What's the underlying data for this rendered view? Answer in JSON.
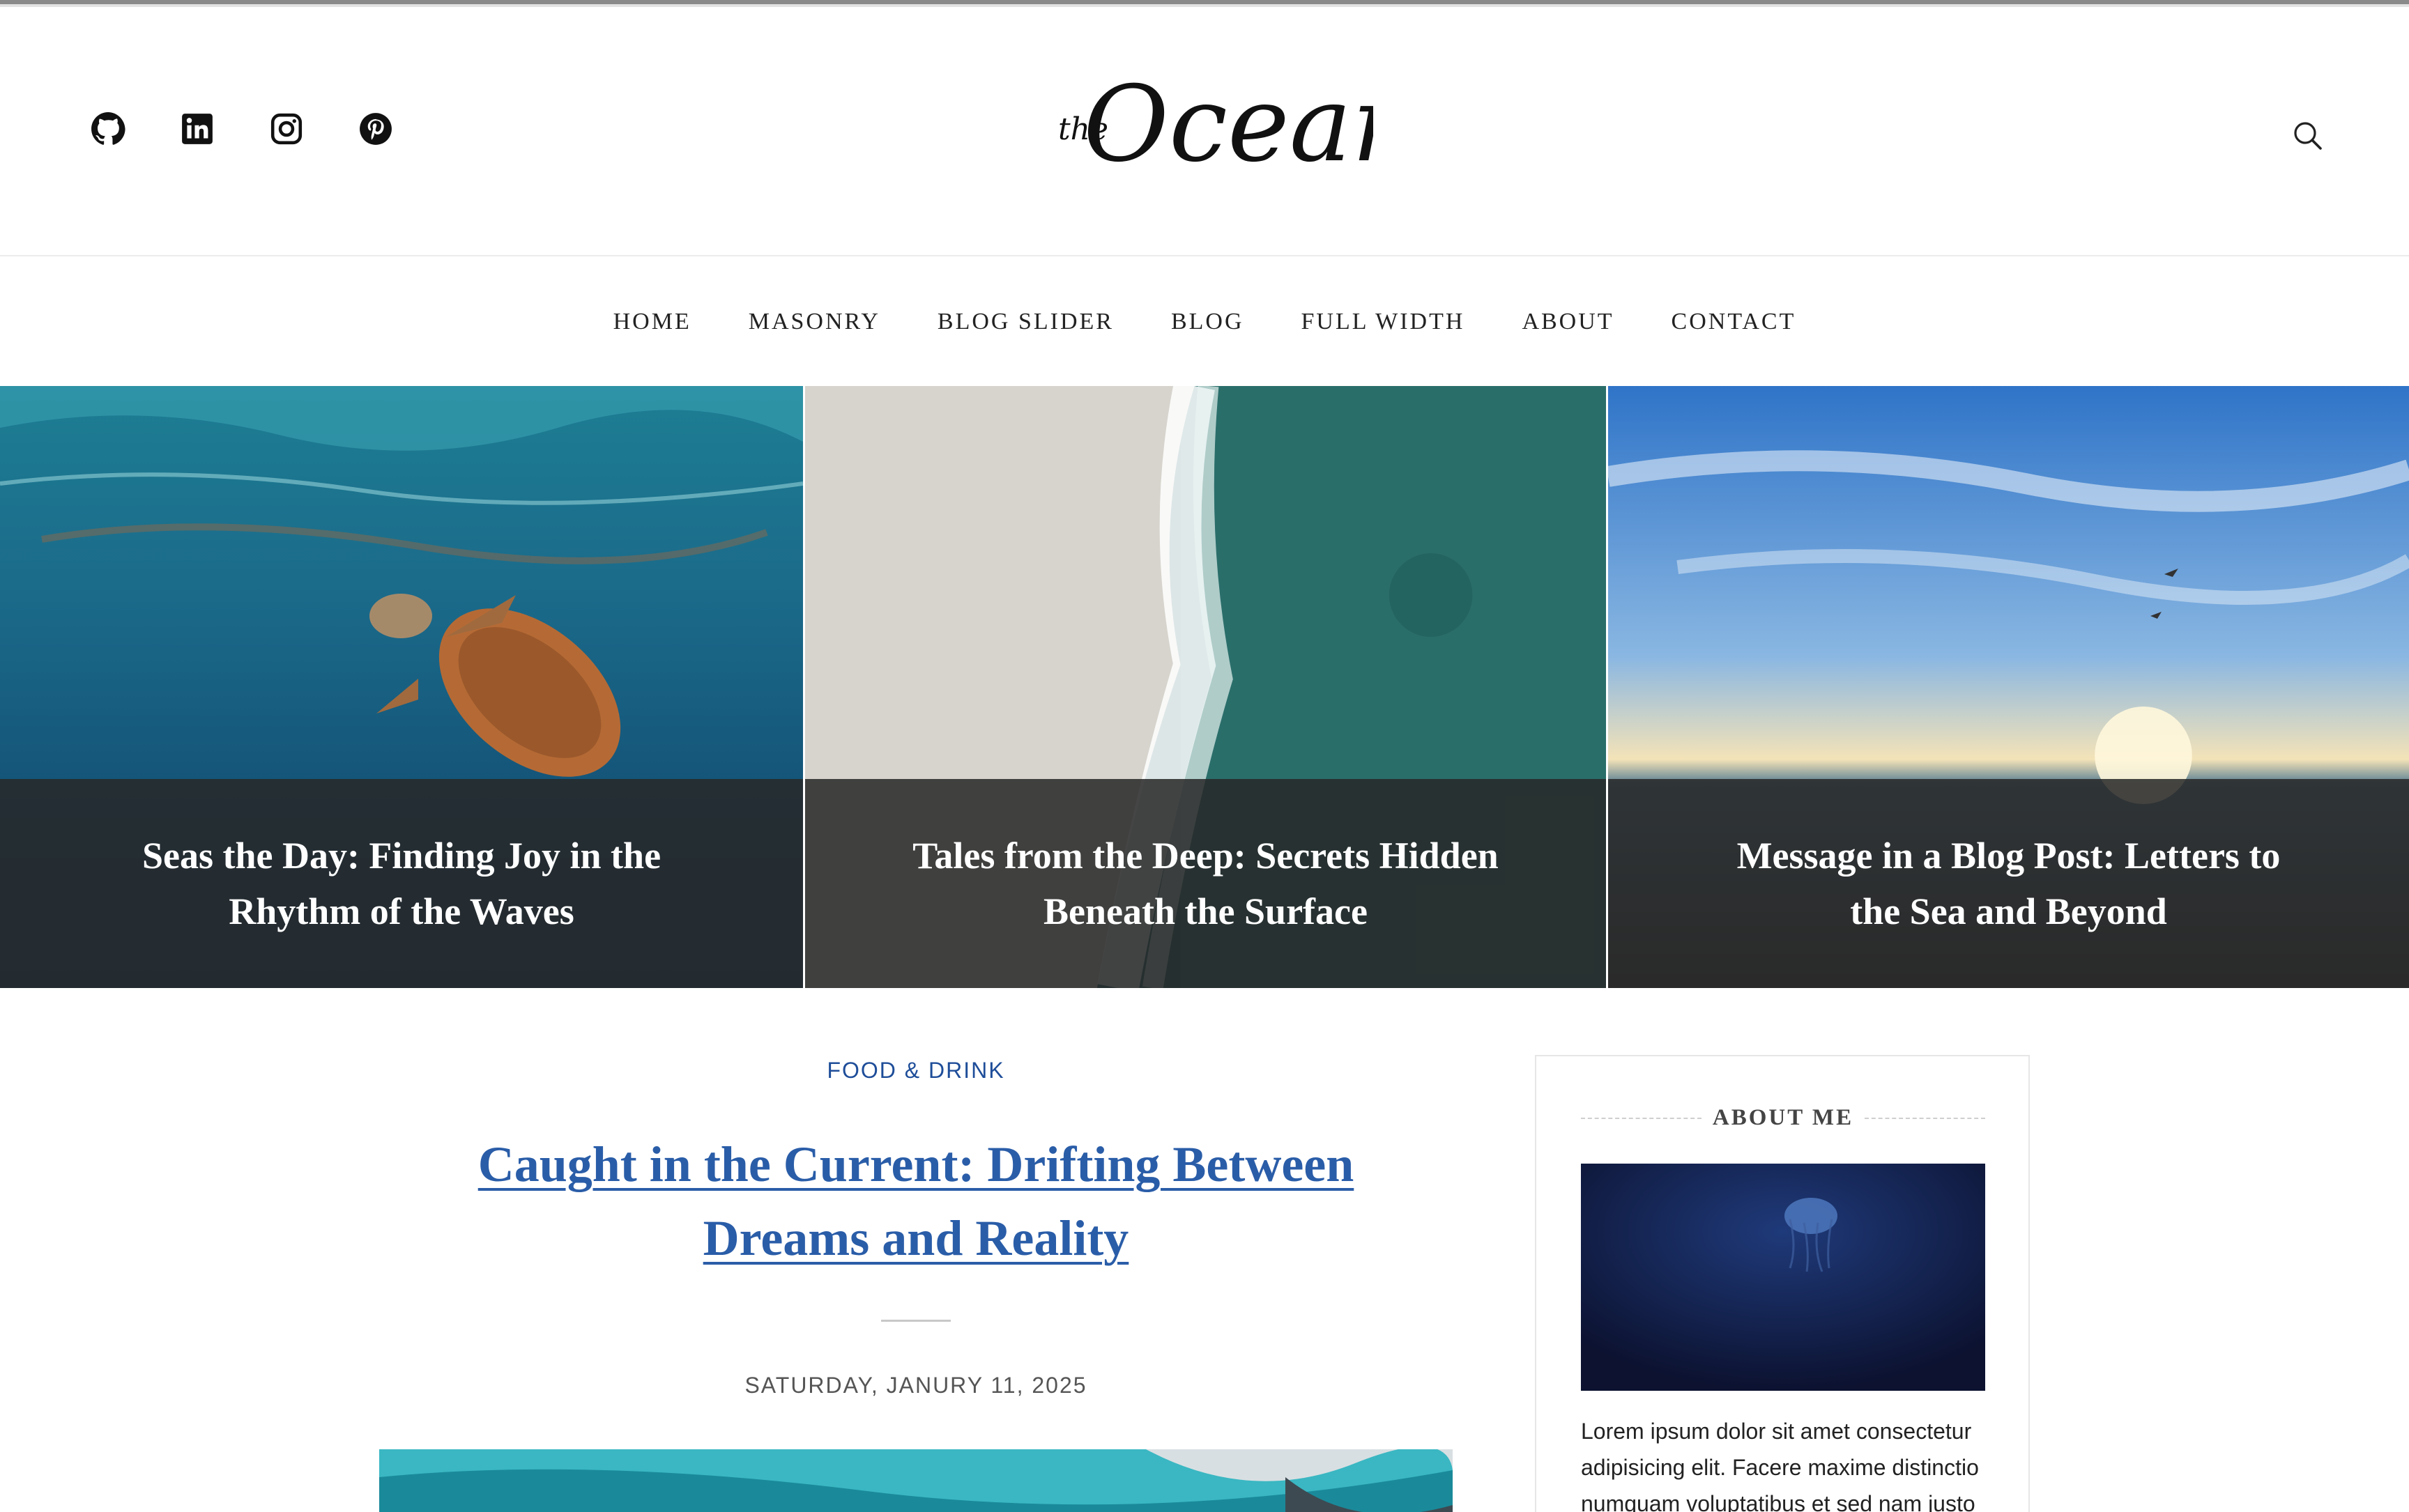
{
  "header": {
    "social_links": [
      {
        "icon": "github-icon",
        "label": "GitHub"
      },
      {
        "icon": "linkedin-icon",
        "label": "LinkedIn"
      },
      {
        "icon": "instagram-icon",
        "label": "Instagram"
      },
      {
        "icon": "pinterest-icon",
        "label": "Pinterest"
      }
    ],
    "logo": {
      "small": "the",
      "main": "Ocean"
    },
    "search_icon": "search-icon"
  },
  "nav": {
    "items": [
      "HOME",
      "MASONRY",
      "BLOG SLIDER",
      "BLOG",
      "FULL WIDTH",
      "ABOUT",
      "CONTACT"
    ]
  },
  "slider": {
    "slides": [
      {
        "title": "Seas the Day: Finding Joy in the Rhythm of the Waves"
      },
      {
        "title": "Tales from the Deep: Secrets Hidden Beneath the Surface"
      },
      {
        "title": "Message in a Blog Post: Letters to the Sea and Beyond"
      }
    ]
  },
  "post": {
    "category": "FOOD & DRINK",
    "title": "Caught in the Current: Drifting Between Dreams and Reality",
    "date": "SATURDAY, JANURY 11, 2025"
  },
  "sidebar": {
    "about_widget": {
      "title": "ABOUT ME",
      "text": "Lorem ipsum dolor sit amet consectetur adipisicing elit. Facere maxime distinctio numquam voluptatibus et sed nam justo"
    }
  },
  "colors": {
    "accent": "#2a5da8",
    "category": "#1e4d99",
    "caption_overlay": "#282828",
    "text": "#222222"
  }
}
